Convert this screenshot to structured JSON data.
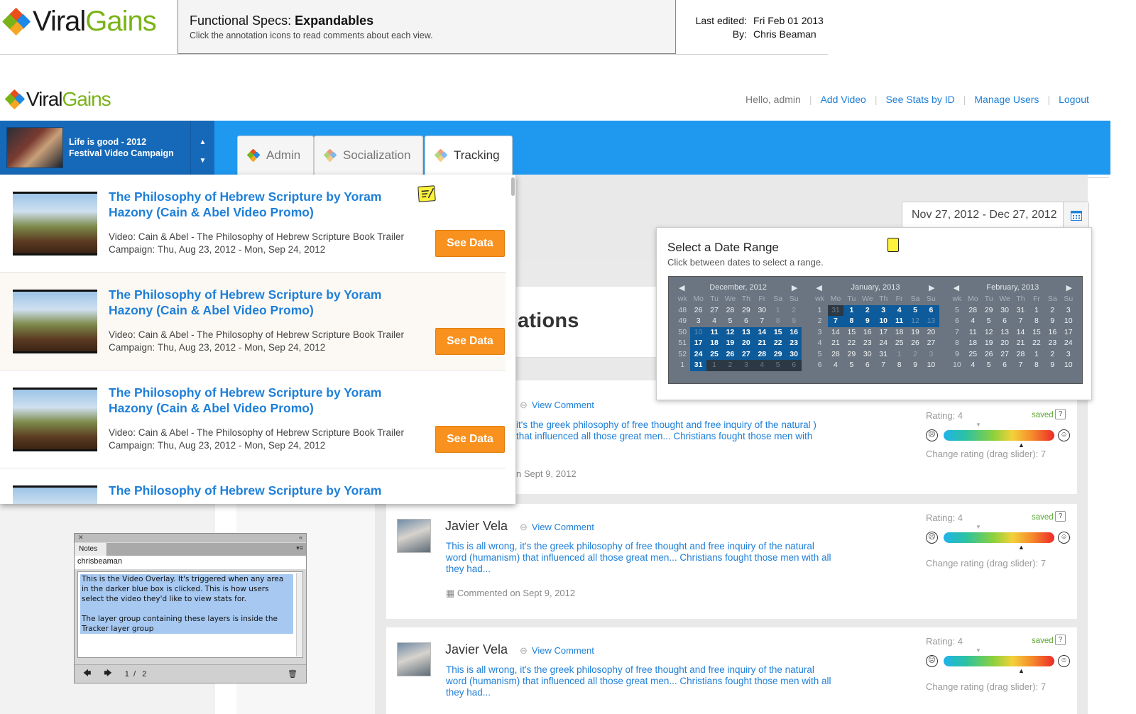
{
  "spec": {
    "brand_left": "Viral",
    "brand_right": "Gains",
    "title_prefix": "Functional Specs: ",
    "title_bold": "Expandables",
    "subtitle": "Click the annotation icons to read comments about each view.",
    "last_edited_label": "Last edited:",
    "last_edited_value": "Fri Feb 01 2013",
    "by_label": "By:",
    "by_value": "Chris Beaman"
  },
  "app": {
    "brand_left": "Viral",
    "brand_right": "Gains",
    "nav": {
      "hello": "Hello, admin",
      "add_video": "Add Video",
      "see_stats": "See Stats by ID",
      "manage_users": "Manage Users",
      "logout": "Logout"
    },
    "campaign": {
      "line1": "Life is good - 2012",
      "line2": "Festival Video Campaign"
    },
    "tabs": [
      "Admin",
      "Socialization",
      "Tracking"
    ],
    "date_range": "Nov 27, 2012 - Dec 27, 2012",
    "section_heading": "ations"
  },
  "videos": [
    {
      "title_line1": "The Philosophy of Hebrew Scripture by Yoram",
      "title_line2": "Hazony (Cain & Abel Video Promo)",
      "video": "Video: Cain & Abel - The Philosophy of Hebrew Scripture Book Trailer",
      "campaign": "Campaign: Thu, Aug 23, 2012 - Mon, Sep 24, 2012",
      "button": "See Data"
    },
    {
      "title_line1": "The Philosophy of Hebrew Scripture by Yoram",
      "title_line2": "Hazony (Cain & Abel Video Promo)",
      "video": "Video: Cain & Abel - The Philosophy of Hebrew Scripture Book Trailer",
      "campaign": "Campaign: Thu, Aug 23, 2012 - Mon, Sep 24, 2012",
      "button": "See Data"
    },
    {
      "title_line1": "The Philosophy of Hebrew Scripture by Yoram",
      "title_line2": "Hazony (Cain & Abel Video Promo)",
      "video": "Video: Cain & Abel - The Philosophy of Hebrew Scripture Book Trailer",
      "campaign": "Campaign: Thu, Aug 23, 2012 - Mon, Sep 24, 2012",
      "button": "See Data"
    },
    {
      "title_line1": "The Philosophy of Hebrew Scripture by Yoram"
    }
  ],
  "picker": {
    "title": "Select a Date Range",
    "subtitle": "Click between dates to select a range.",
    "weekday_headers": [
      "wk",
      "Mo",
      "Tu",
      "We",
      "Th",
      "Fr",
      "Sa",
      "Su"
    ],
    "months": [
      {
        "name": "December, 2012",
        "weeks": [
          [
            "48",
            "26",
            "27",
            "28",
            "29",
            "30",
            "1",
            "2"
          ],
          [
            "49",
            "3",
            "4",
            "5",
            "6",
            "7",
            "8",
            "9"
          ],
          [
            "50",
            "10",
            "11",
            "12",
            "13",
            "14",
            "15",
            "16"
          ],
          [
            "51",
            "17",
            "18",
            "19",
            "20",
            "21",
            "22",
            "23"
          ],
          [
            "52",
            "24",
            "25",
            "26",
            "27",
            "28",
            "29",
            "30"
          ],
          [
            "1",
            "31",
            "1",
            "2",
            "3",
            "4",
            "5",
            "6"
          ]
        ]
      },
      {
        "name": "January, 2013",
        "weeks": [
          [
            "1",
            "31",
            "1",
            "2",
            "3",
            "4",
            "5",
            "6"
          ],
          [
            "2",
            "7",
            "8",
            "9",
            "10",
            "11",
            "12",
            "13"
          ],
          [
            "3",
            "14",
            "15",
            "16",
            "17",
            "18",
            "19",
            "20"
          ],
          [
            "4",
            "21",
            "22",
            "23",
            "24",
            "25",
            "26",
            "27"
          ],
          [
            "5",
            "28",
            "29",
            "30",
            "31",
            "1",
            "2",
            "3"
          ],
          [
            "6",
            "4",
            "5",
            "6",
            "7",
            "8",
            "9",
            "10"
          ]
        ]
      },
      {
        "name": "February, 2013",
        "weeks": [
          [
            "5",
            "28",
            "29",
            "30",
            "31",
            "1",
            "2",
            "3"
          ],
          [
            "6",
            "4",
            "5",
            "6",
            "7",
            "8",
            "9",
            "10"
          ],
          [
            "7",
            "11",
            "12",
            "13",
            "14",
            "15",
            "16",
            "17"
          ],
          [
            "8",
            "18",
            "19",
            "20",
            "21",
            "22",
            "23",
            "24"
          ],
          [
            "9",
            "25",
            "26",
            "27",
            "28",
            "1",
            "2",
            "3"
          ],
          [
            "10",
            "4",
            "5",
            "6",
            "7",
            "8",
            "9",
            "10"
          ]
        ]
      }
    ]
  },
  "comments": [
    {
      "name": "",
      "view_comment": "View Comment",
      "text": "it's the greek philosophy of free thought and free inquiry of the natural ) that influenced all those great men... Christians fought those men with",
      "date": "n Sept 9, 2012",
      "rating": "Rating: 4",
      "saved": "saved",
      "help": "?",
      "change": "Change rating (drag slider): 7"
    },
    {
      "name": "Javier Vela",
      "view_comment": "View Comment",
      "text": "This is all wrong, it's the greek philosophy of free thought and free inquiry of the natural word (humanism) that influenced all those great men... Christians fought those men with all they had...",
      "date": "Commented on Sept 9, 2012",
      "rating": "Rating: 4",
      "saved": "saved",
      "help": "?",
      "change": "Change rating (drag slider): 7"
    },
    {
      "name": "Javier Vela",
      "view_comment": "View Comment",
      "text": "This is all wrong, it's the greek philosophy of free thought and free inquiry of the natural word (humanism) that influenced all those great men... Christians fought those men with all they had...",
      "rating": "Rating: 4",
      "saved": "saved",
      "help": "?",
      "change": "Change rating (drag slider): 7"
    }
  ],
  "notes": {
    "tab": "Notes",
    "author": "chrisbeaman",
    "text": "This is the Video Overlay. It's triggered when any area in the darker blue box is clicked. This is how users select the video they'd like to view stats for.\n\nThe layer group containing these layers is inside the Tracker layer group",
    "page_current": "1",
    "page_sep": "/",
    "page_total": "2"
  }
}
